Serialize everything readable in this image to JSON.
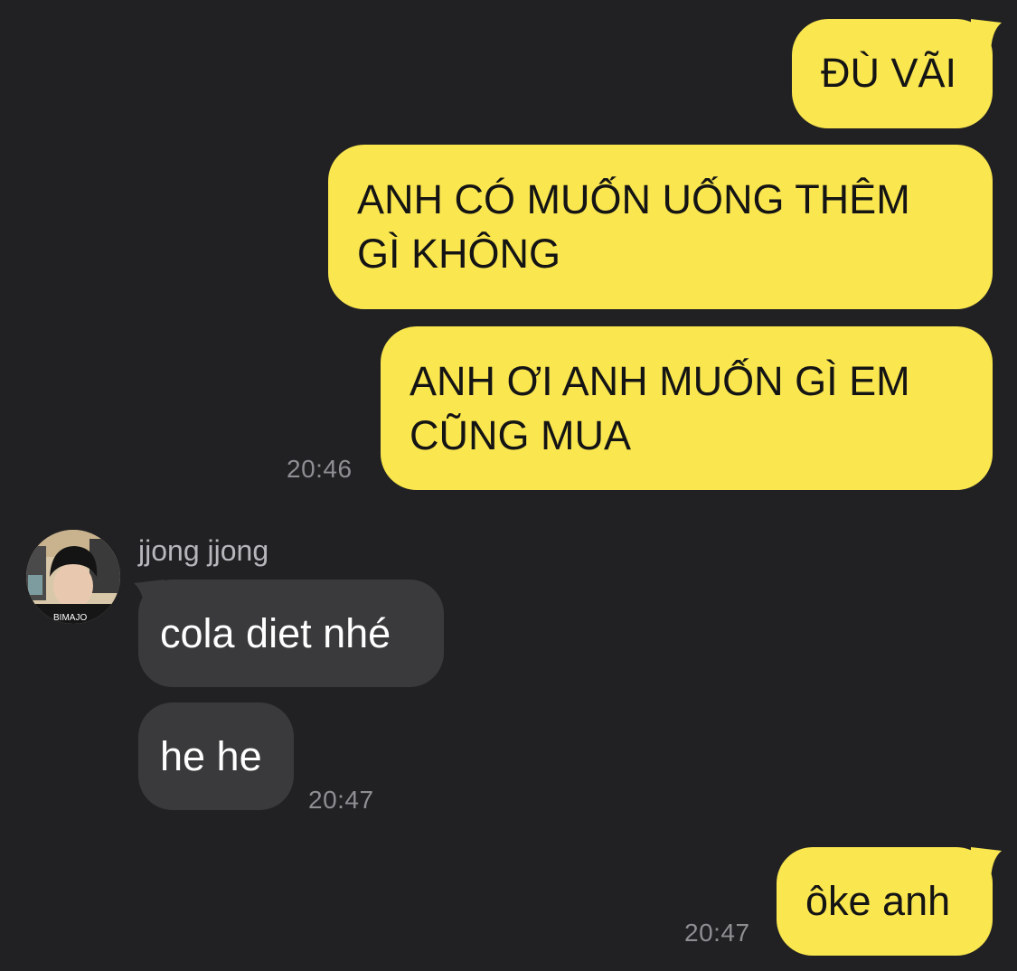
{
  "conversation": {
    "messages": [
      {
        "direction": "outgoing",
        "text": "ĐÙ VÃI"
      },
      {
        "direction": "outgoing",
        "text": "ANH CÓ MUỐN UỐNG THÊM\nGÌ KHÔNG"
      },
      {
        "direction": "outgoing",
        "text": "ANH ƠI ANH MUỐN GÌ EM\nCŨNG MUA",
        "time": "20:46"
      },
      {
        "direction": "incoming",
        "sender": "jjong jjong",
        "text": "cola diet nhé"
      },
      {
        "direction": "incoming",
        "text": "he he",
        "time": "20:47"
      },
      {
        "direction": "outgoing",
        "text": "ôke anh",
        "time": "20:47"
      }
    ]
  },
  "colors": {
    "background": "#212123",
    "outgoing_bubble": "#fae64f",
    "incoming_bubble": "#3a3a3c",
    "timestamp": "#8e8e93"
  }
}
